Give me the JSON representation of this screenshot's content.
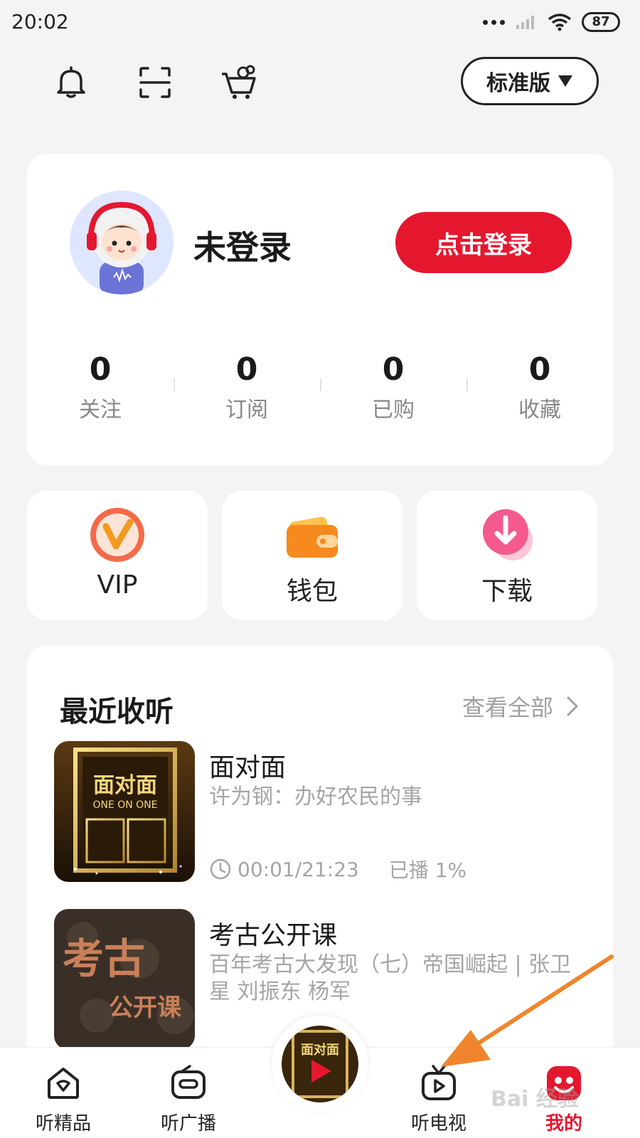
{
  "status_bar": {
    "time": "20:02",
    "battery": "87"
  },
  "top_bar": {
    "edition_label": "标准版"
  },
  "profile": {
    "name": "未登录",
    "login_button": "点击登录"
  },
  "stats": [
    {
      "value": "0",
      "label": "关注"
    },
    {
      "value": "0",
      "label": "订阅"
    },
    {
      "value": "0",
      "label": "已购"
    },
    {
      "value": "0",
      "label": "收藏"
    }
  ],
  "quick_actions": [
    {
      "label": "VIP",
      "icon": "vip-icon"
    },
    {
      "label": "钱包",
      "icon": "wallet-icon"
    },
    {
      "label": "下载",
      "icon": "download-icon"
    }
  ],
  "recent": {
    "title": "最近收听",
    "view_all": "查看全部",
    "items": [
      {
        "title": "面对面",
        "subtitle": "许为钢：办好农民的事",
        "cover_title": "面对面",
        "cover_sub": "ONE ON ONE",
        "time": "00:01/21:23",
        "played": "已播 1%"
      },
      {
        "title": "考古公开课",
        "subtitle": "百年考古大发现（七）帝国崛起 | 张卫星 刘振东 杨军",
        "cover_title": "考古",
        "cover_sub": "公开课"
      }
    ]
  },
  "tabs": [
    {
      "label": "听精品",
      "icon": "home-icon"
    },
    {
      "label": "听广播",
      "icon": "radio-icon"
    },
    {
      "label": "听电视",
      "icon": "tv-icon"
    },
    {
      "label": "我的",
      "icon": "profile-icon"
    }
  ],
  "colors": {
    "accent": "#e5172f",
    "background": "#f4f4f4",
    "annotation_arrow": "#f0852d"
  },
  "watermark": "Bai 经验"
}
